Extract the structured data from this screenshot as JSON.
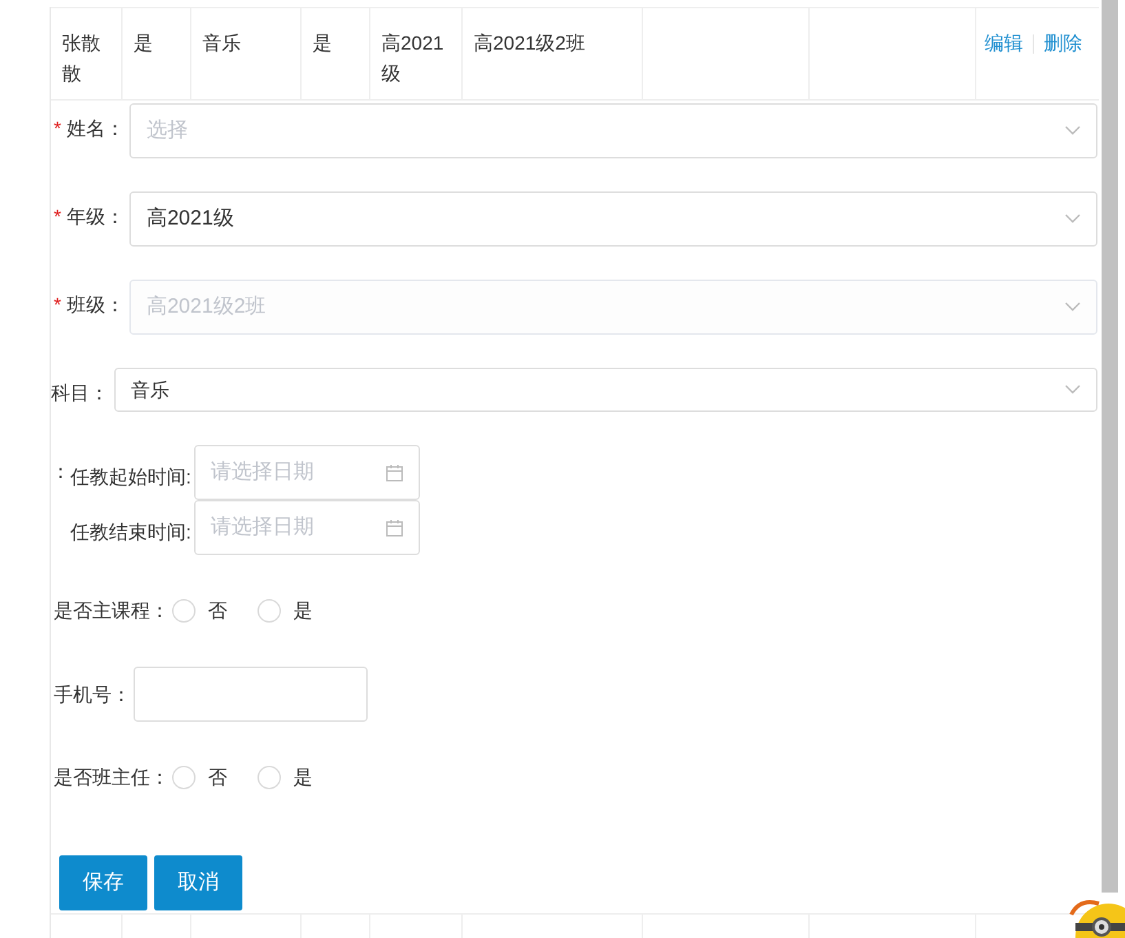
{
  "table_row": {
    "cells": [
      "张散散",
      "是",
      "音乐",
      "是",
      "高2021级",
      "高2021级2班"
    ],
    "actions": [
      "编辑",
      "删除"
    ]
  },
  "selects": [
    {
      "label": "姓名：",
      "required_mark": "*",
      "placeholder": "选择",
      "disabled": false
    },
    {
      "label": "年级：",
      "required_mark": "*",
      "value": "高2021级",
      "disabled": false
    },
    {
      "label": "班级：",
      "required_mark": "*",
      "value": "高2021级2班",
      "disabled": true
    },
    {
      "label": "科目：",
      "value": "音乐",
      "disabled": false
    }
  ],
  "stray_colon": "：",
  "dates": [
    {
      "label": "任教起始时间:",
      "placeholder": "请选择日期"
    },
    {
      "label": "任教结束时间:",
      "placeholder": "请选择日期"
    }
  ],
  "main_course": {
    "label": "是否主课程：",
    "options": [
      {
        "label": "否",
        "selected": false
      },
      {
        "label": "是",
        "selected": false
      }
    ]
  },
  "phone": {
    "label": "手机号："
  },
  "head_teacher": {
    "label": "是否班主任：",
    "options": [
      {
        "label": "否",
        "selected": false
      },
      {
        "label": "是",
        "selected": false
      }
    ]
  },
  "buttons": [
    "保存",
    "取消"
  ]
}
